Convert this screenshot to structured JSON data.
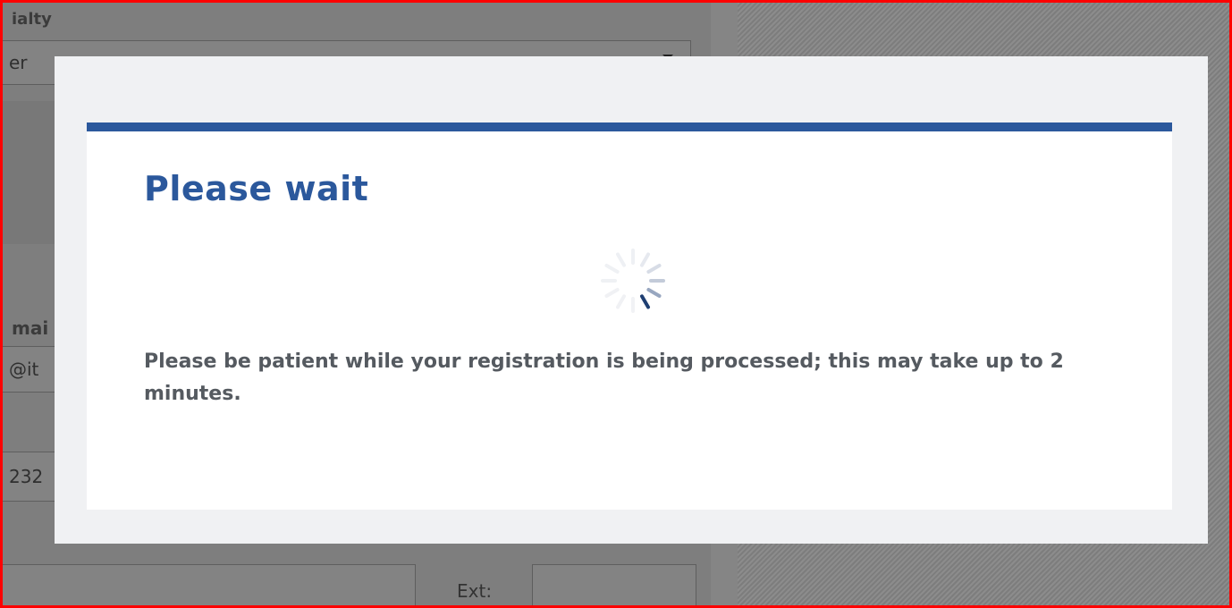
{
  "background_form": {
    "specialty_label": "ialty",
    "specialty_value": "er",
    "email_label": "mai",
    "email_value": "@it",
    "phone_value": "232",
    "ext_label": "Ext:"
  },
  "modal": {
    "title": "Please wait",
    "message": "Please be patient while your registration is being processed; this may take up to 2 minutes.",
    "accent_color": "#2b589c"
  },
  "icons": {
    "spinner": "loading-spinner-icon"
  }
}
